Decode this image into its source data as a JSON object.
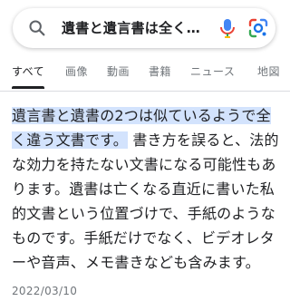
{
  "search": {
    "query": "遺書と遺言書は全く…"
  },
  "tabs": [
    "すべて",
    "画像",
    "動画",
    "書籍",
    "ニュース",
    "地図"
  ],
  "snippet": {
    "highlighted": "遺言書と遺書の2つは似ているようで全く違う文書です。",
    "rest": "書き方を誤ると、法的な効力を持たない文書になる可能性もあります。遺書は亡くなる直近に書いた私的文書という位置づけで、手紙のようなものです。手紙だけでなく、ビデオレターや音声、メモ書きなども含みます。",
    "date": "2022/03/10"
  },
  "colors": {
    "highlight": "#d3e3fd",
    "mic_blue": "#4285f4",
    "lens_blue": "#1a73e8"
  }
}
